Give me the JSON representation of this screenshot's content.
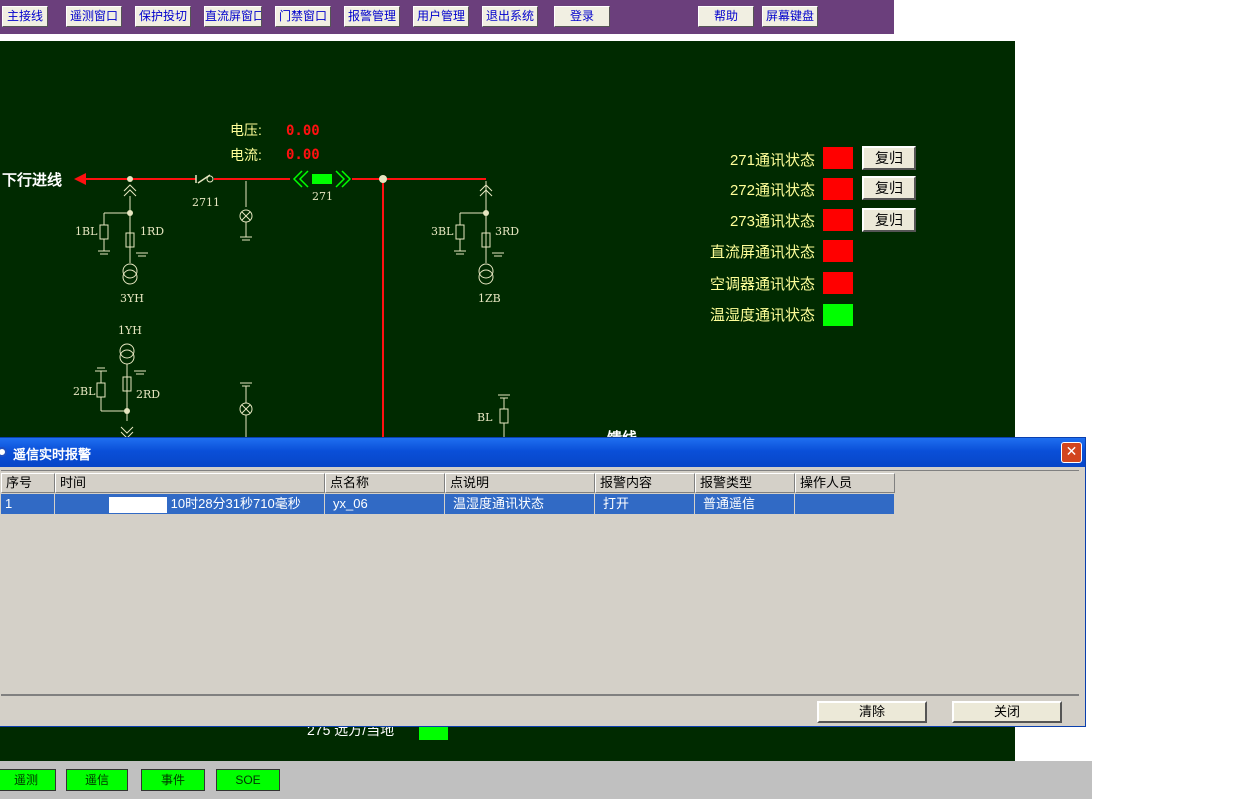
{
  "toolbar": {
    "items": [
      "主接线",
      "遥测窗口",
      "保护投切",
      "直流屏窗口",
      "门禁窗口",
      "报警管理",
      "用户管理",
      "退出系统",
      "登录",
      "帮助",
      "屏幕键盘"
    ]
  },
  "diagram": {
    "voltage_label": "电压:",
    "voltage_value": "0.00",
    "current_label": "电流:",
    "current_value": "0.00",
    "incoming_line": "下行进线",
    "switch_2711": "2711",
    "breaker_271": "271",
    "labels": {
      "bl1": "1BL",
      "rd1": "1RD",
      "yh3": "3YH",
      "bl3": "3BL",
      "rd3": "3RD",
      "zb1": "1ZB",
      "yh1": "1YH",
      "bl2": "2BL",
      "rd2": "2RD",
      "bl": "BL"
    },
    "bus_label_partial": "馈线",
    "bottom_partial": "275 远方/当地"
  },
  "comm_status": [
    {
      "label": "271通讯状态",
      "color": "#ff0000",
      "reset": "复归"
    },
    {
      "label": "272通讯状态",
      "color": "#ff0000",
      "reset": "复归"
    },
    {
      "label": "273通讯状态",
      "color": "#ff0000",
      "reset": "复归"
    },
    {
      "label": "直流屏通讯状态",
      "color": "#ff0000"
    },
    {
      "label": "空调器通讯状态",
      "color": "#ff0000"
    },
    {
      "label": "温湿度通讯状态",
      "color": "#00ff00"
    }
  ],
  "dialog": {
    "title": "遥信实时报警",
    "columns": [
      "序号",
      "时间",
      "点名称",
      "点说明",
      "报警内容",
      "报警类型",
      "操作人员"
    ],
    "rows": [
      {
        "index": "1",
        "time": "10时28分31秒710毫秒",
        "point": "yx_06",
        "desc": "温湿度通讯状态",
        "content": "打开",
        "type": "普通遥信",
        "operator": ""
      }
    ],
    "clear_button": "清除",
    "close_button": "关闭"
  },
  "statusbar": {
    "items": [
      "遥测",
      "遥信",
      "事件",
      "SOE"
    ]
  }
}
